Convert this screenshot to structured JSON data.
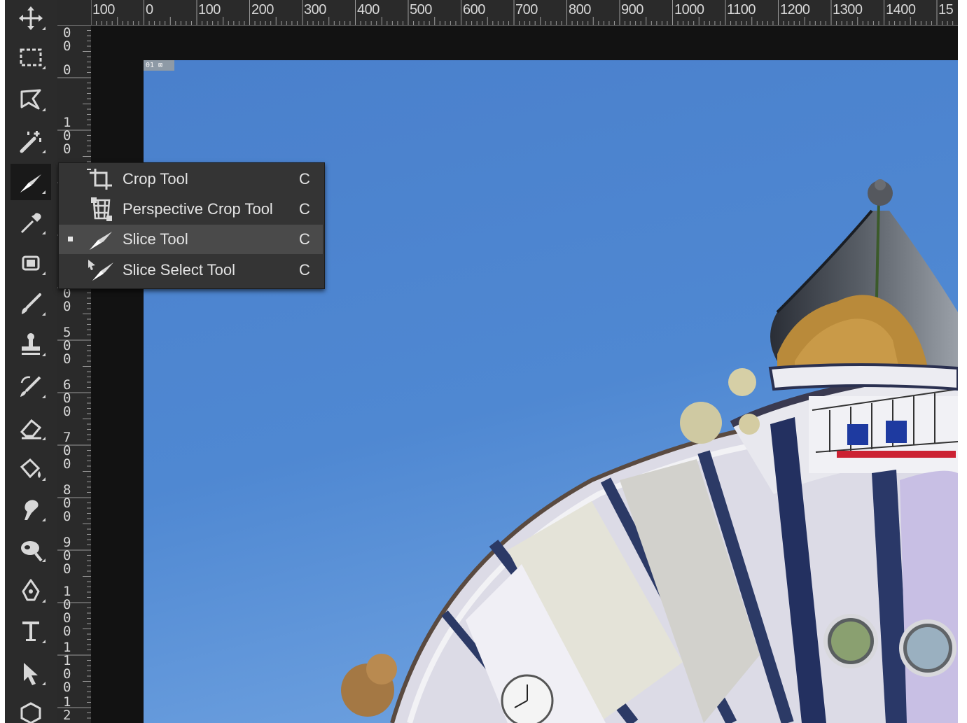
{
  "ruler": {
    "horizontal": [
      "100",
      "0",
      "100",
      "200",
      "300",
      "400",
      "500",
      "600",
      "700",
      "800",
      "900",
      "1000",
      "1100",
      "1200",
      "1300",
      "1400",
      "15"
    ],
    "vertical": [
      "00",
      "0",
      "100",
      "200",
      "300",
      "400",
      "500",
      "600",
      "700",
      "800",
      "900",
      "1000",
      "1100",
      "12"
    ]
  },
  "slice_badge": "01 ⊠",
  "flyout": {
    "items": [
      {
        "label": "Crop Tool",
        "shortcut": "C",
        "icon": "crop-icon",
        "selected": false
      },
      {
        "label": "Perspective Crop Tool",
        "shortcut": "C",
        "icon": "perspective-crop-icon",
        "selected": false
      },
      {
        "label": "Slice Tool",
        "shortcut": "C",
        "icon": "slice-icon",
        "selected": true
      },
      {
        "label": "Slice Select Tool",
        "shortcut": "C",
        "icon": "slice-select-icon",
        "selected": false
      }
    ]
  },
  "toolbar": {
    "tools": [
      "move-icon",
      "marquee-icon",
      "lasso-icon",
      "magic-wand-icon",
      "slice-icon",
      "eyedropper-icon",
      "spot-healing-icon",
      "brush-icon",
      "stamp-icon",
      "history-brush-icon",
      "eraser-icon",
      "paint-bucket-icon",
      "smudge-icon",
      "dodge-icon",
      "pen-icon",
      "type-icon",
      "path-selection-icon",
      "shape-icon"
    ]
  },
  "colors": {
    "toolbar_bg": "#2b2b2b",
    "flyout_bg": "#343434",
    "flyout_selected": "#4a4a4a",
    "sky": "#4f86cf"
  }
}
